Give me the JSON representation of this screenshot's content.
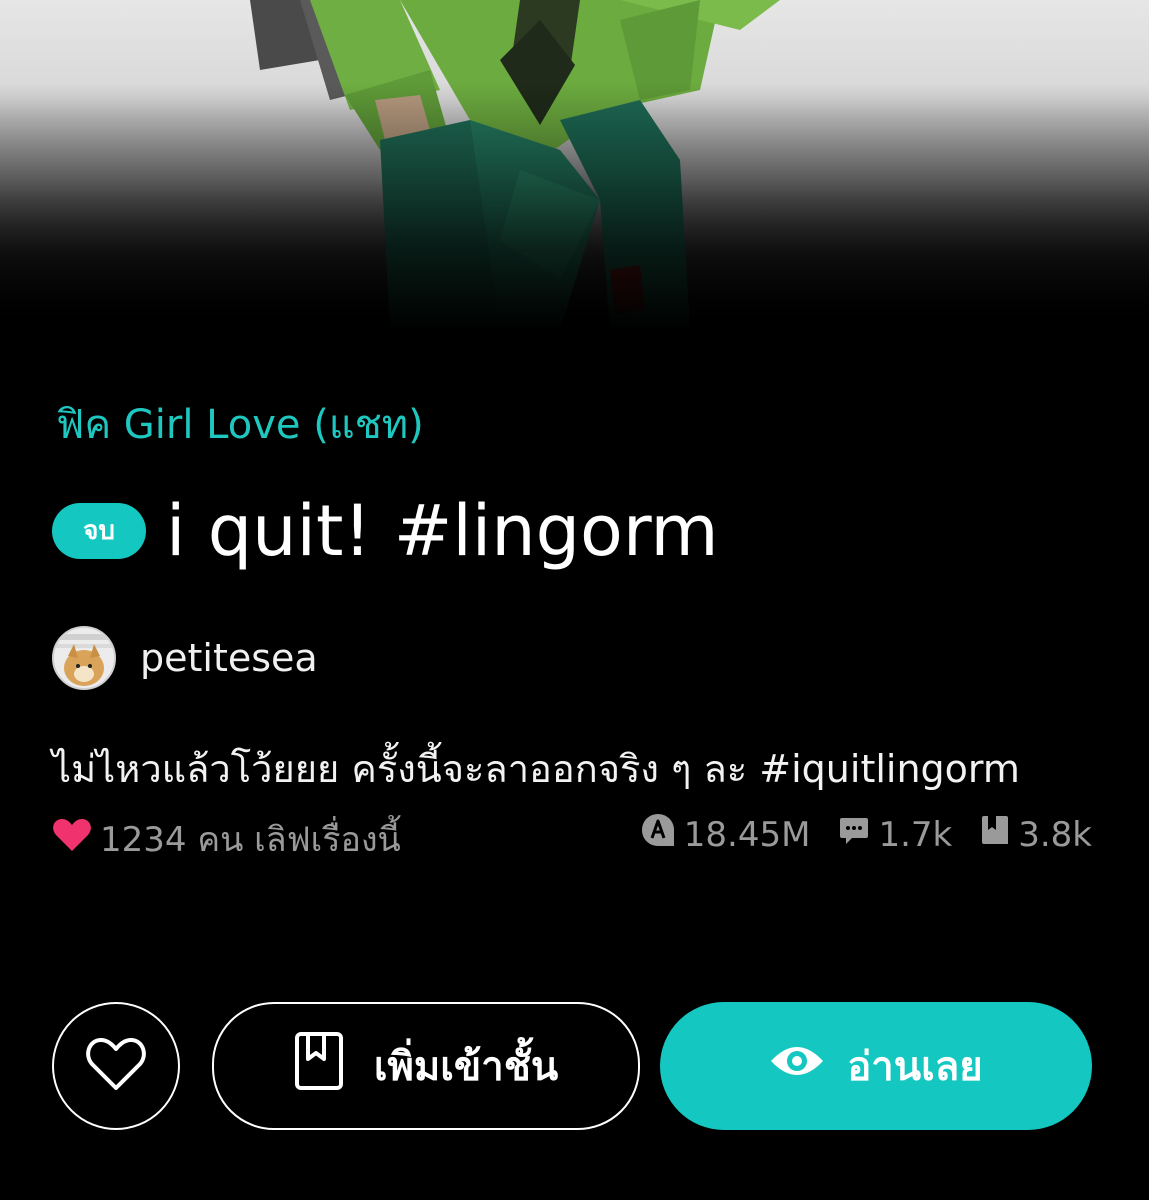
{
  "story": {
    "category": "ฟิค Girl Love (แชท)",
    "status_badge": "จบ",
    "title": "i quit! #lingorm",
    "author": "petitesea",
    "description": "ไม่ไหวแล้วโว้ยยย ครั้งนี้จะลาออกจริง ๆ ละ #iquitlingorm"
  },
  "stats": {
    "love_text": "1234 คน เลิฟเรื่องนี้",
    "reads": "18.45M",
    "comments": "1.7k",
    "library_adds": "3.8k"
  },
  "actions": {
    "add_library_label": "เพิ่มเข้าชั้น",
    "read_label": "อ่านเลย"
  },
  "icons": {
    "heart_filled": "heart-filled-icon",
    "reads": "reads-icon",
    "comments": "comment-icon",
    "library": "book-icon",
    "like": "heart-outline-icon",
    "bookmark": "bookmark-book-icon",
    "eye": "eye-icon"
  },
  "colors": {
    "accent": "#14c7c0",
    "category": "#1ec8c0",
    "heart": "#f0326e",
    "muted": "#9a9a9a",
    "background": "#000000"
  }
}
